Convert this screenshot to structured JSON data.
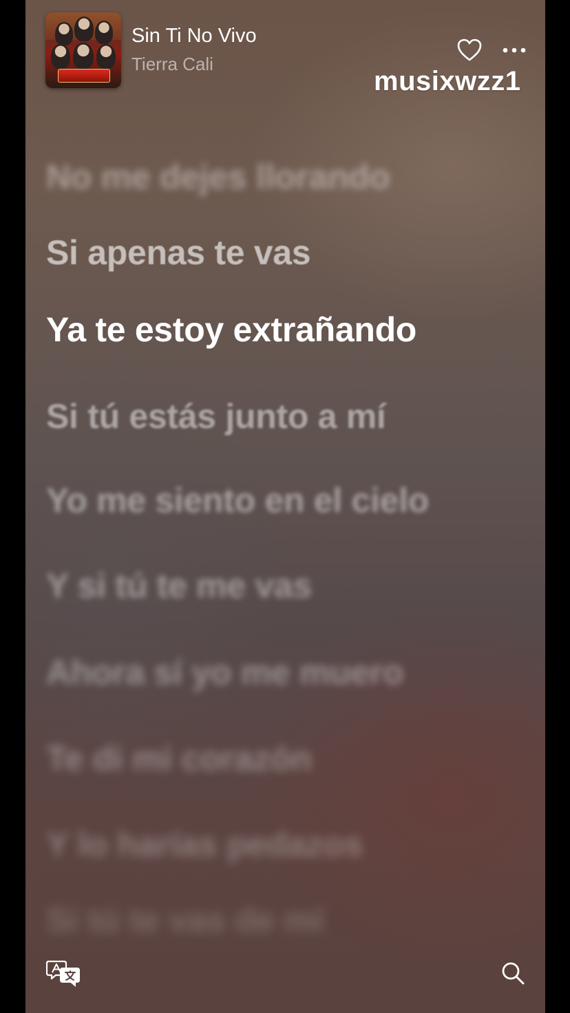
{
  "now_playing": {
    "title": "Sin Ti No Vivo",
    "artist": "Tierra Cali",
    "album_art_icon": "album-cover"
  },
  "header_actions": {
    "favorite_icon": "heart-outline-icon",
    "more_icon": "ellipsis-icon"
  },
  "watermark": "musixwzz1",
  "lyrics": {
    "current_index": 2,
    "lines": [
      "No me dejes llorando",
      "Si apenas te vas",
      "Ya te estoy extrañando",
      "Si tú estás junto a mí",
      "Yo me siento en el cielo",
      "Y si tú te me vas",
      "Ahora sí yo me muero",
      "Te di mi corazón",
      "Y lo harías pedazos",
      "Si tú te vas de mí"
    ]
  },
  "bottom_actions": {
    "translate_icon": "translate-icon",
    "search_icon": "search-icon"
  },
  "colors": {
    "background_top": "#6b5448",
    "background_bottom": "#5a423e",
    "active_lyric": "#ffffff",
    "frame": "#000000"
  }
}
